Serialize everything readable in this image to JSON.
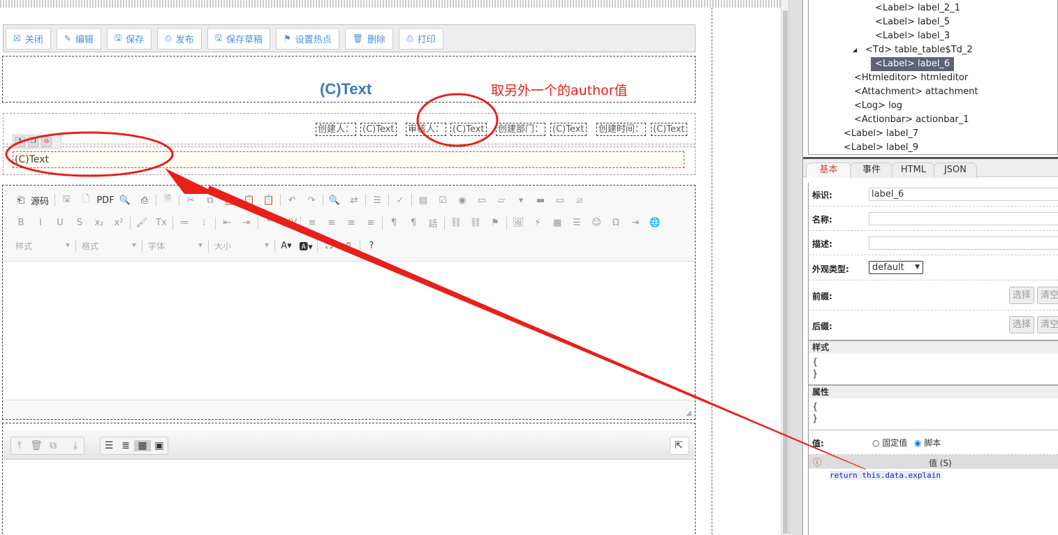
{
  "actionbar": {
    "buttons": [
      {
        "label": "关闭",
        "icon": "close-icon"
      },
      {
        "label": "编辑",
        "icon": "pencil-icon"
      },
      {
        "label": "保存",
        "icon": "save-icon"
      },
      {
        "label": "发布",
        "icon": "publish-icon"
      },
      {
        "label": "保存草稿",
        "icon": "save-draft-icon"
      },
      {
        "label": "设置热点",
        "icon": "hotspot-icon"
      },
      {
        "label": "删除",
        "icon": "trash-icon"
      },
      {
        "label": "打印",
        "icon": "print-icon"
      }
    ]
  },
  "form": {
    "title": "(C)Text",
    "info": [
      {
        "label": "创建人：",
        "value": "(C)Text"
      },
      {
        "label": "审核人：",
        "value": "(C)Text"
      },
      {
        "label": "创建部门：",
        "value": "(C)Text"
      },
      {
        "label": "创建时间：",
        "value": "(C)Text"
      }
    ],
    "selected_field": "(C)Text"
  },
  "annotation": {
    "text": "取另外一个的author值",
    "color": "#e8201a"
  },
  "editor": {
    "source_label": "源码",
    "combos": [
      "样式",
      "格式",
      "字体",
      "大小"
    ]
  },
  "tree": {
    "nodes": [
      {
        "text": "<Label> label_2_1",
        "depth": 3
      },
      {
        "text": "<Label> label_5",
        "depth": 3
      },
      {
        "text": "<Label> label_3",
        "depth": 3
      },
      {
        "text": "<Td> table_table$Td_2",
        "depth": 2,
        "expanded": true
      },
      {
        "text": "<Label> label_6",
        "depth": 3,
        "selected": true
      },
      {
        "text": "<Htmleditor> htmleditor",
        "depth": 1
      },
      {
        "text": "<Attachment> attachment",
        "depth": 1
      },
      {
        "text": "<Log> log",
        "depth": 1
      },
      {
        "text": "<Actionbar> actionbar_1",
        "depth": 1
      },
      {
        "text": "<Label> label_7",
        "depth": 0
      },
      {
        "text": "<Label> label_9",
        "depth": 0
      }
    ]
  },
  "tabs": [
    {
      "label": "基本",
      "active": true
    },
    {
      "label": "事件"
    },
    {
      "label": "HTML"
    },
    {
      "label": "JSON"
    }
  ],
  "props": {
    "id_label": "标识:",
    "id_value": "label_6",
    "name_label": "名称:",
    "name_value": "",
    "desc_label": "描述:",
    "desc_value": "",
    "appearance_label": "外观类型:",
    "appearance_value": "default",
    "prefix_label": "前缀:",
    "suffix_label": "后缀:",
    "select_btn": "选择",
    "clear_btn": "清空",
    "style_head": "样式",
    "style_open": "{",
    "style_close": "}",
    "attr_head": "属性",
    "attr_open": "{",
    "attr_close": "}",
    "value_label": "值:",
    "radio_fixed": "固定值",
    "radio_script": "脚本",
    "radio_selected": "脚本",
    "value_head": "值 (S)",
    "code": "return this.data.explain"
  }
}
